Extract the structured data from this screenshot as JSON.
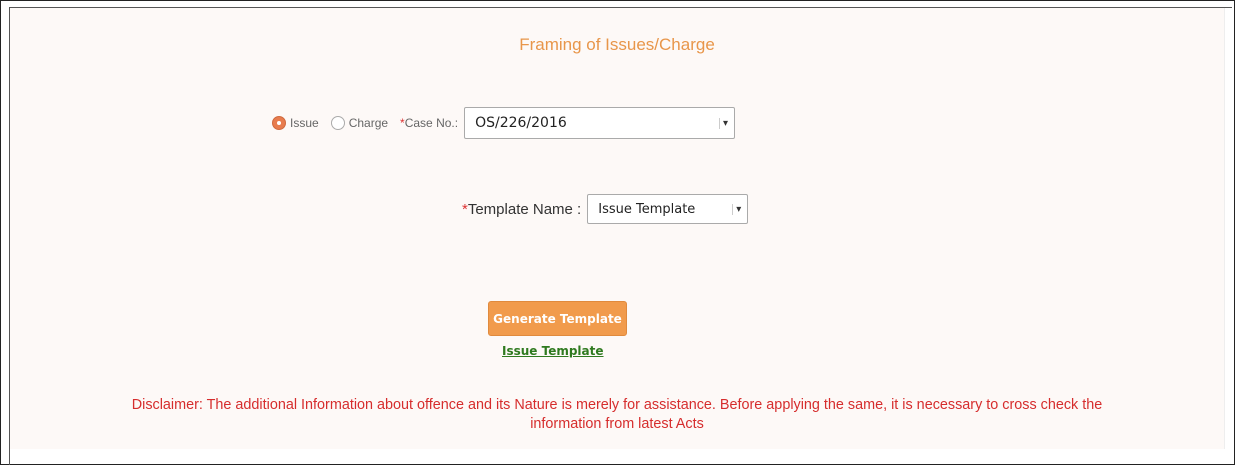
{
  "form": {
    "title": "Framing of Issues/Charge",
    "type_options": [
      {
        "label": "Issue",
        "checked": true
      },
      {
        "label": "Charge",
        "checked": false
      }
    ],
    "case_no": {
      "required_marker": "*",
      "label": "Case No.:",
      "value": "OS/226/2016"
    },
    "template_name": {
      "required_marker": "*",
      "label": "Template Name :",
      "value": "Issue Template"
    },
    "generate_button": "Generate Template",
    "template_link": "Issue Template",
    "disclaimer_line1": "Disclaimer: The additional Information about offence and its Nature is merely for assistance. Before applying the same, it is necessary to cross check the",
    "disclaimer_line2": "information from latest Acts"
  },
  "colors": {
    "accent": "#f19b4c",
    "title": "#e8964a",
    "disclaimer": "#d62d2d",
    "link": "#2f7a1f",
    "background": "#fdf9f7"
  },
  "icons": [
    "radio-checked-icon",
    "radio-unchecked-icon",
    "dropdown-arrow-icon"
  ]
}
